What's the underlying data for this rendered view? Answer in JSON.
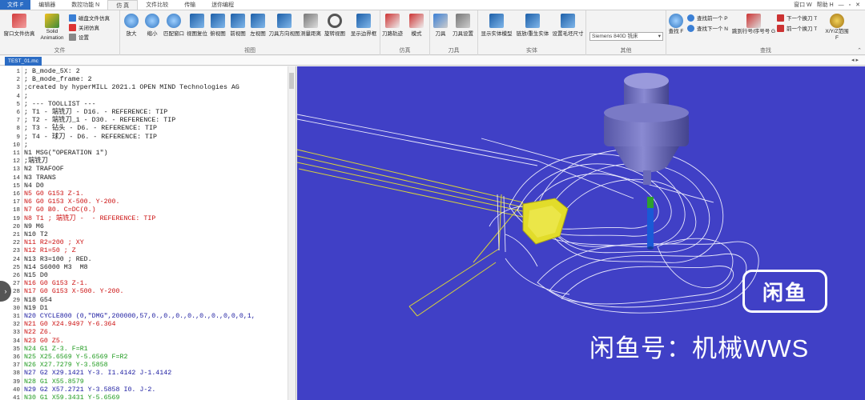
{
  "menu": {
    "file_tab": "文件 F",
    "tabs": [
      "编辑器",
      "数控功能 N",
      "仿 真",
      "文件比较",
      "传输",
      "迷你编程"
    ],
    "active_tab": "仿 真",
    "window_menu": "窗口 W",
    "help_menu": "帮助 H"
  },
  "ribbon": {
    "file_group": {
      "label": "文件",
      "open_button": "窗口文件仿真",
      "solid_button": "Solid Animation",
      "sub_items": [
        "磁盘文件仿真",
        "关闭仿真",
        "设置"
      ]
    },
    "view_group": {
      "label": "视图",
      "buttons": [
        "放大",
        "缩小",
        "匹配窗口",
        "视图复位",
        "俯视图",
        "前视图",
        "左视图",
        "刀具方向视图",
        "测量距离",
        "旋转视图",
        "显示边界框"
      ]
    },
    "sim_group": {
      "label": "仿真",
      "buttons": [
        "刀路轨迹",
        "模式"
      ]
    },
    "tool_group": {
      "label": "刀具",
      "buttons": [
        "刀具",
        "刀具设置"
      ]
    },
    "solid_group": {
      "label": "实体",
      "buttons": [
        "显示实体模型",
        "链放/重生实体",
        "设置毛坯尺寸"
      ]
    },
    "other_group": {
      "label": "其他",
      "controller_value": "Siemens 840D 铣床"
    },
    "find_group": {
      "label": "查找",
      "find_button": "查找 F",
      "find_prev": "查找前一个 P",
      "find_next": "查找下一个 N",
      "goto_line": "跳到行号/序号号 G",
      "next_toolchange": "下一个换刀 T",
      "prev_toolchange": "前一个换刀 T",
      "xyz_range": "X/Y/Z范围 F"
    }
  },
  "document_tab": "TEST_01.mc",
  "code_lines": [
    {
      "n": "1",
      "text": "; B_mode_5X: 2",
      "color": "#1a1a1a"
    },
    {
      "n": "2",
      "text": "; B_mode_frame: 2",
      "color": "#1a1a1a"
    },
    {
      "n": "3",
      "text": ";created by hyperMILL 2021.1 OPEN MIND Technologies AG",
      "color": "#1a1a1a"
    },
    {
      "n": "4",
      "text": ";",
      "color": "#1a1a1a"
    },
    {
      "n": "5",
      "text": "; --- TOOLLIST ---",
      "color": "#1a1a1a"
    },
    {
      "n": "6",
      "text": "; T1 - 端铣刀 - D16. - REFERENCE: TIP",
      "color": "#1a1a1a"
    },
    {
      "n": "7",
      "text": "; T2 - 端铣刀_1 - D30. - REFERENCE: TIP",
      "color": "#1a1a1a"
    },
    {
      "n": "8",
      "text": "; T3 - 钻头 - D6. - REFERENCE: TIP",
      "color": "#1a1a1a"
    },
    {
      "n": "9",
      "text": "; T4 - 球刀 - D6. - REFERENCE: TIP",
      "color": "#1a1a1a"
    },
    {
      "n": "10",
      "text": ";",
      "color": "#1a1a1a"
    },
    {
      "n": "11",
      "text": "N1 MSG(\"OPERATION 1\")",
      "color": "#1a1a1a"
    },
    {
      "n": "12",
      "text": ";端铣刀",
      "color": "#1a1a1a"
    },
    {
      "n": "13",
      "text": "N2 TRAFOOF",
      "color": "#1a1a1a"
    },
    {
      "n": "14",
      "text": "N3 TRANS",
      "color": "#1a1a1a"
    },
    {
      "n": "15",
      "text": "N4 D0",
      "color": "#1a1a1a"
    },
    {
      "n": "16",
      "text": "N5 G0 G153 Z-1.",
      "color": "#cc1111"
    },
    {
      "n": "17",
      "text": "N6 G0 G153 X-500. Y-200.",
      "color": "#cc1111"
    },
    {
      "n": "18",
      "text": "N7 G0 B0. C=DC(0.)",
      "color": "#cc1111"
    },
    {
      "n": "19",
      "text": "N8 T1 ; 端铣刀 -  - REFERENCE: TIP",
      "color": "#cc1111"
    },
    {
      "n": "20",
      "text": "N9 M6",
      "color": "#1a1a1a"
    },
    {
      "n": "21",
      "text": "N10 T2",
      "color": "#1a1a1a"
    },
    {
      "n": "22",
      "text": "N11 R2=200 ; XY",
      "color": "#cc1111"
    },
    {
      "n": "23",
      "text": "N12 R1=50 ; Z",
      "color": "#cc1111"
    },
    {
      "n": "24",
      "text": "N13 R3=100 ; RED.",
      "color": "#1a1a1a"
    },
    {
      "n": "25",
      "text": "N14 S6000 M3  M8",
      "color": "#1a1a1a"
    },
    {
      "n": "26",
      "text": "N15 D0",
      "color": "#1a1a1a"
    },
    {
      "n": "27",
      "text": "N16 G0 G153 Z-1.",
      "color": "#cc1111"
    },
    {
      "n": "28",
      "text": "N17 G0 G153 X-500. Y-200.",
      "color": "#cc1111"
    },
    {
      "n": "29",
      "text": "N18 G54",
      "color": "#1a1a1a"
    },
    {
      "n": "30",
      "text": "N19 D1",
      "color": "#1a1a1a"
    },
    {
      "n": "31",
      "text": "N20 CYCLE800 (0,\"DMG\",200000,57,0.,0.,0.,0.,0.,0.,0,0,0,1,",
      "color": "#1a1aa0"
    },
    {
      "n": "32",
      "text": "N21 G0 X24.9497 Y-6.364",
      "color": "#cc1111"
    },
    {
      "n": "33",
      "text": "N22 Z6.",
      "color": "#cc1111"
    },
    {
      "n": "34",
      "text": "N23 G0 Z5.",
      "color": "#cc1111"
    },
    {
      "n": "35",
      "text": "N24 G1 Z-3. F=R1",
      "color": "#1e9a1e"
    },
    {
      "n": "36",
      "text": "N25 X25.6569 Y-5.6569 F=R2",
      "color": "#1e9a1e"
    },
    {
      "n": "37",
      "text": "N26 X27.7279 Y-3.5858",
      "color": "#1e9a1e"
    },
    {
      "n": "38",
      "text": "N27 G2 X29.1421 Y-3. I1.4142 J-1.4142",
      "color": "#1a1aa0"
    },
    {
      "n": "39",
      "text": "N28 G1 X55.8579",
      "color": "#1e9a1e"
    },
    {
      "n": "40",
      "text": "N29 G2 X57.2721 Y-3.5858 I0. J-2.",
      "color": "#1a1aa0"
    },
    {
      "n": "41",
      "text": "N30 G1 X59.3431 Y-5.6569",
      "color": "#1e9a1e"
    }
  ],
  "watermark": {
    "logo_text": "闲鱼",
    "caption": "闲鱼号：机械WWS"
  },
  "colors": {
    "viewport_bg": "#4040c6",
    "accent_blue": "#2b6cc4",
    "tool_holder": "#6a6ab8",
    "stock_yellow": "#e2dc2a"
  }
}
